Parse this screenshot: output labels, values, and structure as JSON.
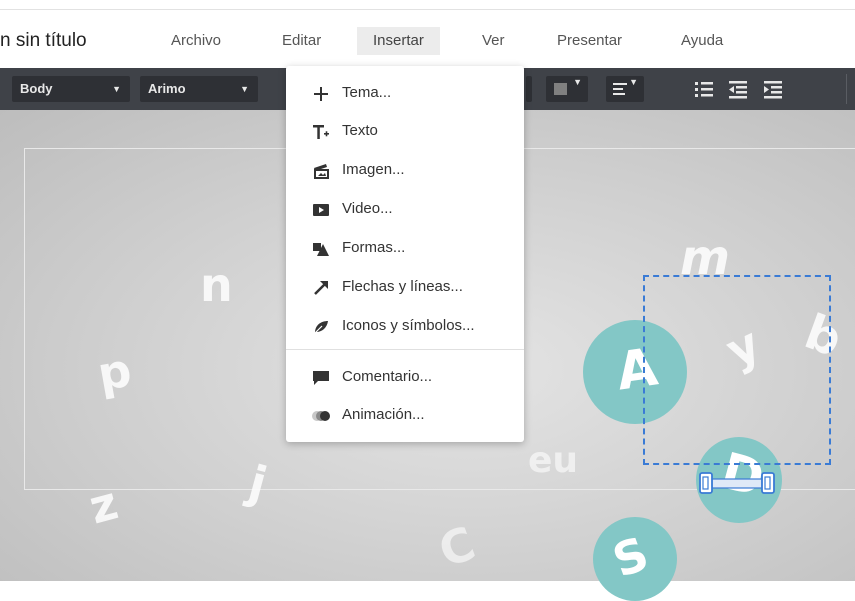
{
  "document": {
    "title": "n sin título"
  },
  "menu": {
    "items": [
      {
        "label": "Archivo"
      },
      {
        "label": "Editar"
      },
      {
        "label": "Insertar",
        "active": true
      },
      {
        "label": "Ver"
      },
      {
        "label": "Presentar"
      },
      {
        "label": "Ayuda"
      }
    ]
  },
  "toolbar": {
    "style_select": "Body",
    "font_select": "Arimo"
  },
  "insert_menu": {
    "items": [
      {
        "label": "Tema...",
        "icon": "plus-icon"
      },
      {
        "label": "Texto",
        "icon": "text-icon"
      },
      {
        "label": "Imagen...",
        "icon": "image-icon"
      },
      {
        "label": "Video...",
        "icon": "video-icon"
      },
      {
        "label": "Formas...",
        "icon": "shapes-icon"
      },
      {
        "label": "Flechas y líneas...",
        "icon": "arrow-icon"
      },
      {
        "label": "Iconos y símbolos...",
        "icon": "leaf-icon"
      },
      {
        "label": "Comentario...",
        "icon": "comment-icon"
      },
      {
        "label": "Animación...",
        "icon": "animation-icon"
      }
    ]
  },
  "canvas": {
    "letters": [
      "n",
      "p",
      "z",
      "j",
      "m",
      "b",
      "A",
      "D",
      "C",
      "S",
      "y",
      "eu"
    ]
  },
  "colors": {
    "accent_teal": "#83c7c6",
    "selection_blue": "#3a7bd5",
    "toolbar_bg": "#3f4248"
  }
}
